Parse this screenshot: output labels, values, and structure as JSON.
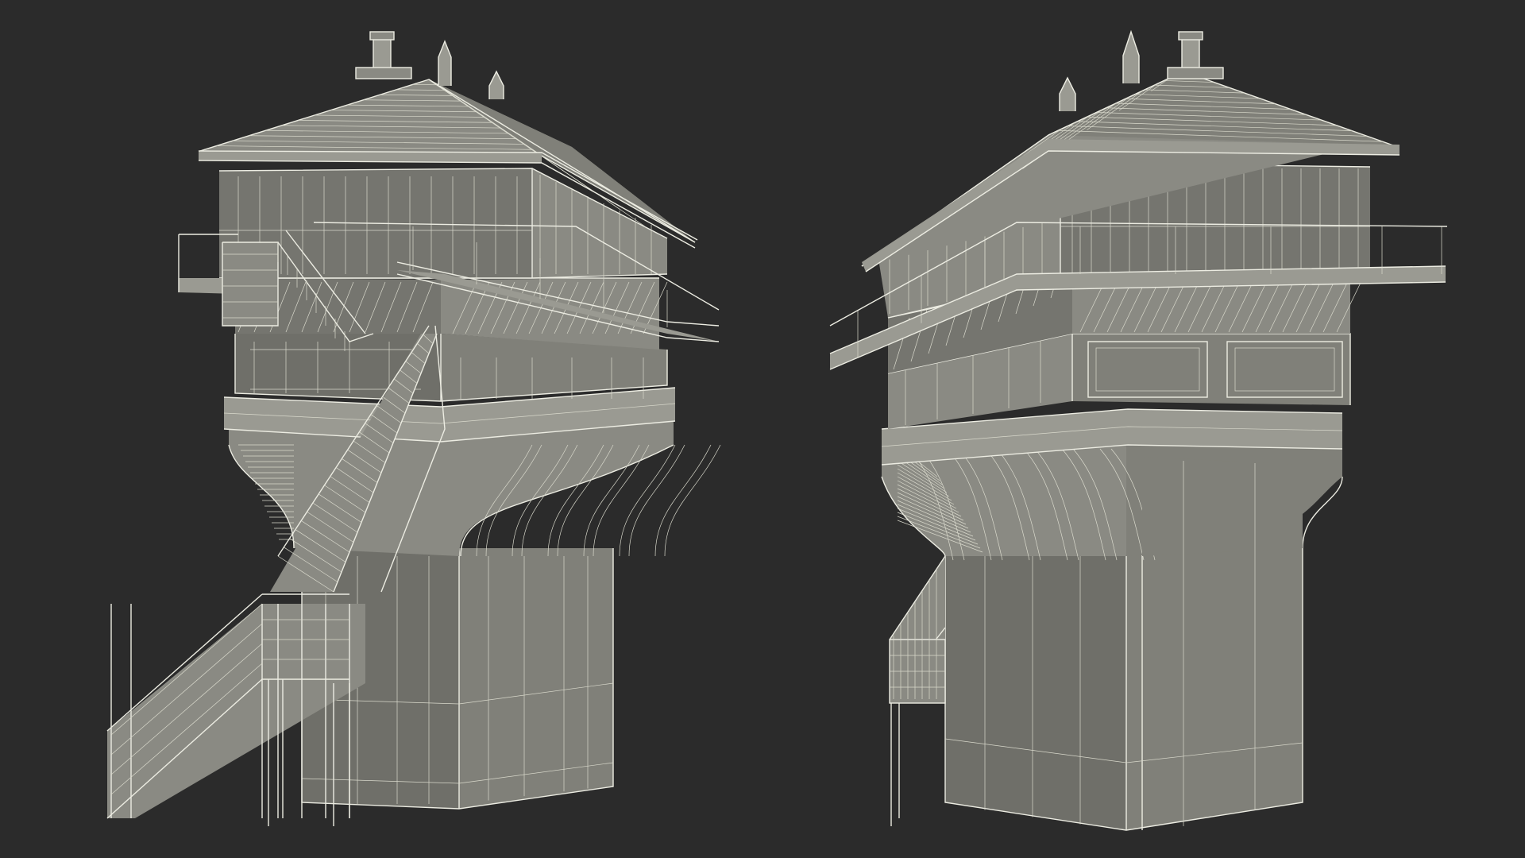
{
  "scene": {
    "background_color": "#2b2b2b",
    "model_face_color": "#808079",
    "wire_color": "#e8e8dc",
    "views": [
      {
        "id": "front-left",
        "subject": "signal-box-tower"
      },
      {
        "id": "rear-right",
        "subject": "signal-box-tower"
      }
    ]
  }
}
